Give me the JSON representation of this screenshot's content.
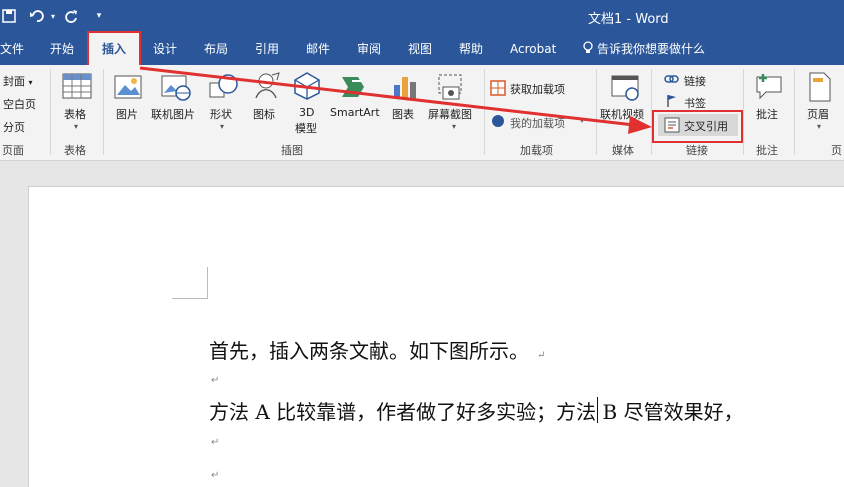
{
  "window": {
    "title": "文档1  -  Word"
  },
  "quick_access": {
    "save_icon": "save-icon",
    "undo_icon": "undo-icon",
    "redo_icon": "redo-icon",
    "customize_icon": "customize-icon"
  },
  "tabs": [
    {
      "label": "文件"
    },
    {
      "label": "开始"
    },
    {
      "label": "插入"
    },
    {
      "label": "设计"
    },
    {
      "label": "布局"
    },
    {
      "label": "引用"
    },
    {
      "label": "邮件"
    },
    {
      "label": "审阅"
    },
    {
      "label": "视图"
    },
    {
      "label": "帮助"
    },
    {
      "label": "Acrobat"
    }
  ],
  "tell_me": "告诉我你想要做什么",
  "ribbon": {
    "pages": {
      "cover": "封面",
      "blank": "空白页",
      "break": "分页",
      "group": "页面"
    },
    "table": {
      "label": "表格",
      "group": "表格"
    },
    "illustrations": {
      "picture": "图片",
      "online_picture": "联机图片",
      "shapes": "形状",
      "icons": "图标",
      "model_line1": "3D",
      "model_line2": "模型",
      "smartart": "SmartArt",
      "chart": "图表",
      "screenshot": "屏幕截图",
      "group": "插图"
    },
    "addins": {
      "get": "获取加载项",
      "my": "我的加载项",
      "group": "加载项"
    },
    "media": {
      "online_video": "联机视频",
      "group": "媒体"
    },
    "links": {
      "link": "链接",
      "bookmark": "书签",
      "cross_ref": "交叉引用",
      "group": "链接"
    },
    "comments": {
      "comment": "批注",
      "group": "批注"
    },
    "header_footer": {
      "header": "页眉",
      "group": "页"
    }
  },
  "document": {
    "line1": "首先，插入两条文献。如下图所示。",
    "line2": "方法 A 比较靠谱，作者做了好多实验；方法 B 尽管效果好，",
    "para_mark": "↵"
  },
  "colors": {
    "accent": "#2b579a",
    "highlight": "#e03030"
  }
}
